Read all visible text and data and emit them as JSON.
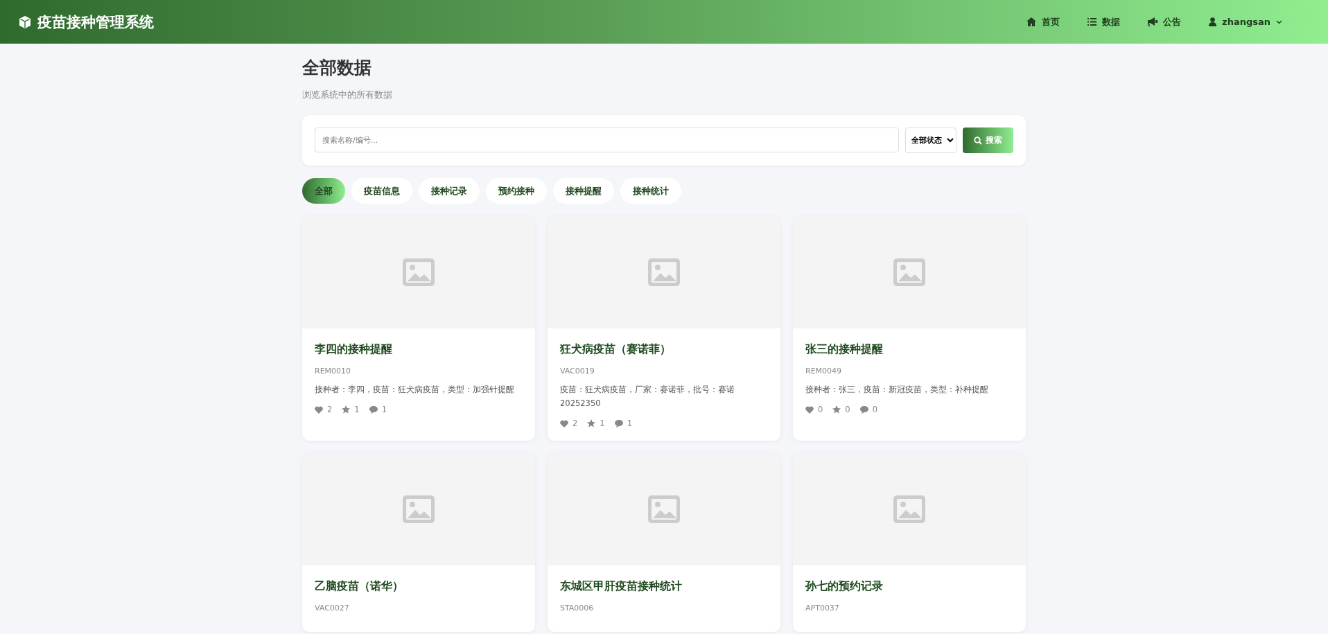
{
  "header": {
    "brand": "疫苗接种管理系统",
    "nav": [
      {
        "kind": "home",
        "label": "首页"
      },
      {
        "kind": "list",
        "label": "数据"
      },
      {
        "kind": "announce",
        "label": "公告"
      },
      {
        "kind": "user",
        "label": "zhangsan"
      }
    ]
  },
  "page": {
    "title": "全部数据",
    "subtitle": "浏览系统中的所有数据"
  },
  "search": {
    "placeholder": "搜索名称/编号...",
    "status": "全部状态",
    "button": "搜索"
  },
  "tabs": [
    {
      "label": "全部",
      "selected": true
    },
    {
      "label": "疫苗信息",
      "selected": false
    },
    {
      "label": "接种记录",
      "selected": false
    },
    {
      "label": "预约接种",
      "selected": false
    },
    {
      "label": "接种提醒",
      "selected": false
    },
    {
      "label": "接种统计",
      "selected": false
    }
  ],
  "cards": [
    {
      "title": "李四的接种提醒",
      "code": "REM0010",
      "desc": "接种者：李四，疫苗：狂犬病疫苗，类型：加强针提醒",
      "likes": "2",
      "stars": "1",
      "comments": "1"
    },
    {
      "title": "狂犬病疫苗（赛诺菲）",
      "code": "VAC0019",
      "desc": "疫苗：狂犬病疫苗，厂家：赛诺菲，批号：赛诺20252350",
      "likes": "2",
      "stars": "1",
      "comments": "1"
    },
    {
      "title": "张三的接种提醒",
      "code": "REM0049",
      "desc": "接种者：张三，疫苗：新冠疫苗，类型：补种提醒",
      "likes": "0",
      "stars": "0",
      "comments": "0"
    },
    {
      "title": "乙脑疫苗（诺华）",
      "code": "VAC0027"
    },
    {
      "title": "东城区甲肝疫苗接种统计",
      "code": "STA0006"
    },
    {
      "title": "孙七的预约记录",
      "code": "APT0037"
    }
  ]
}
